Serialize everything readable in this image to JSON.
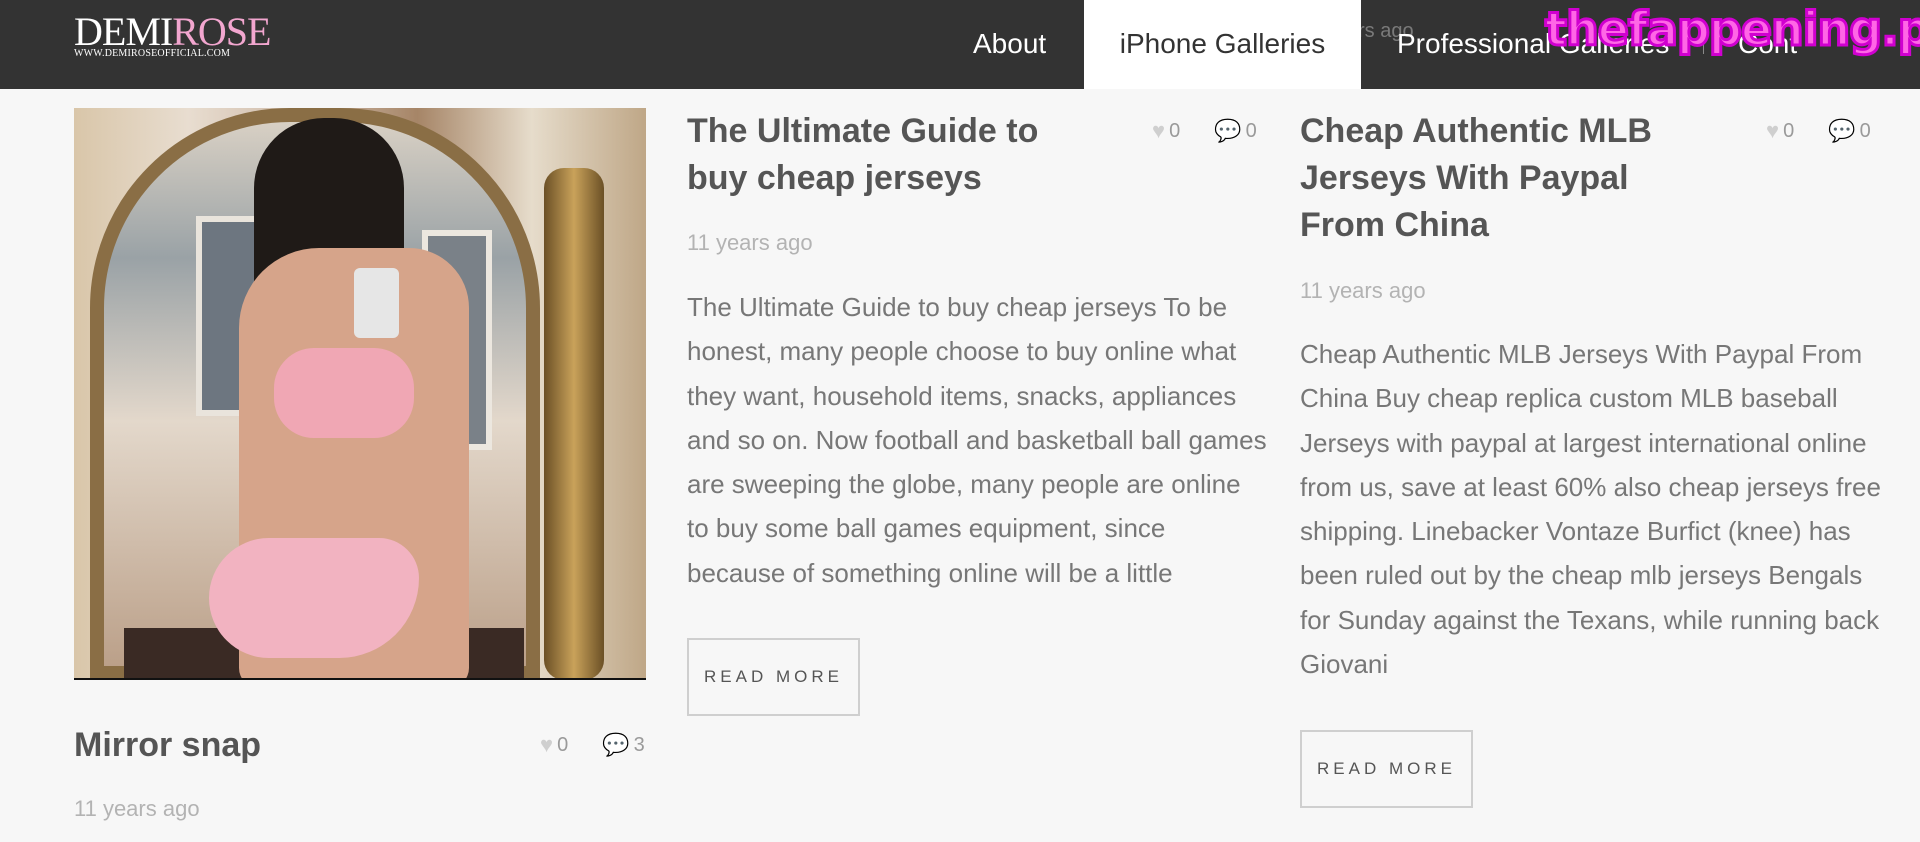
{
  "header": {
    "logo_main_prefix": "DEMI",
    "logo_main_suffix": "ROSE",
    "logo_sub": "WWW.DEMIROSEOFFICIAL.COM",
    "nav": [
      {
        "label": "About"
      },
      {
        "label": "iPhone Galleries",
        "active": true
      },
      {
        "label": "Professional Galleries"
      },
      {
        "label": "Cont"
      }
    ],
    "ghost_text": "rs ago",
    "watermark": "thefappening.plus"
  },
  "posts": [
    {
      "title": "Mirror snap",
      "likes": "0",
      "comments": "3",
      "date": "11 years ago"
    },
    {
      "title": "The Ultimate Guide to buy cheap jerseys",
      "likes": "0",
      "comments": "0",
      "date": "11 years ago",
      "excerpt": "The Ultimate Guide to buy cheap jerseys To be honest, many people choose to buy online what they want, household items, snacks, appliances and so on. Now football and basketball ball games are sweeping the globe, many people are online to buy some ball games equipment, since because of something online will be a little",
      "button": "READ MORE"
    },
    {
      "title": "Cheap Authentic MLB Jerseys With Paypal From China",
      "likes": "0",
      "comments": "0",
      "date": "11 years ago",
      "excerpt": "Cheap Authentic MLB Jerseys With Paypal From China Buy cheap replica custom MLB baseball Jerseys with paypal at largest international online from us, save at least 60% also cheap jerseys free shipping. Linebacker Vontaze Burfict (knee) has been ruled out by the cheap mlb jerseys Bengals for Sunday against the Texans, while running back Giovani",
      "button": "READ MORE"
    }
  ],
  "icons": {
    "like": "heart-icon",
    "comment": "comment-icon"
  }
}
